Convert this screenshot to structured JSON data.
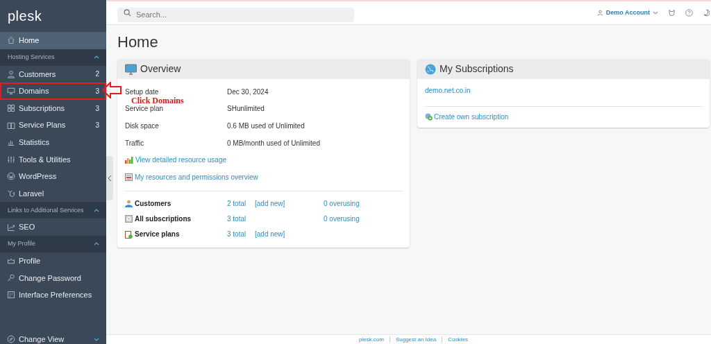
{
  "logo": "plesk",
  "sidebar": {
    "items": [
      {
        "kind": "item",
        "label": "Home",
        "selected": true,
        "annotated": false
      },
      {
        "kind": "section",
        "label": "Hosting Services",
        "expanded": true
      },
      {
        "kind": "item",
        "label": "Customers",
        "count": "2",
        "selected": false,
        "annotated": false
      },
      {
        "kind": "item",
        "label": "Domains",
        "count": "3",
        "selected": false,
        "annotated": true
      },
      {
        "kind": "item",
        "label": "Subscriptions",
        "count": "3",
        "selected": false,
        "annotated": false
      },
      {
        "kind": "item",
        "label": "Service Plans",
        "count": "3",
        "selected": false,
        "annotated": false
      },
      {
        "kind": "item",
        "label": "Statistics",
        "selected": false,
        "annotated": false
      },
      {
        "kind": "item",
        "label": "Tools & Utilities",
        "selected": false,
        "annotated": false
      },
      {
        "kind": "item",
        "label": "WordPress",
        "selected": false,
        "annotated": false
      },
      {
        "kind": "item",
        "label": "Laravel",
        "selected": false,
        "annotated": false
      },
      {
        "kind": "section",
        "label": "Links to Additional Services",
        "expanded": true
      },
      {
        "kind": "item",
        "label": "SEO",
        "selected": false,
        "annotated": false
      },
      {
        "kind": "section",
        "label": "My Profile",
        "expanded": true
      },
      {
        "kind": "item",
        "label": "Profile",
        "selected": false,
        "annotated": false
      },
      {
        "kind": "item",
        "label": "Change Password",
        "selected": false,
        "annotated": false
      },
      {
        "kind": "item",
        "label": "Interface Preferences",
        "selected": false,
        "annotated": false
      }
    ],
    "change_view": {
      "label": "Change View",
      "expanded": false
    }
  },
  "topbar": {
    "search": {
      "placeholder": "Search..."
    },
    "account": "Demo Account"
  },
  "page_title": "Home",
  "overview": {
    "title": "Overview",
    "details": [
      {
        "label": "Setup date",
        "value": "Dec 30, 2024"
      },
      {
        "label": "Service plan",
        "value": "SHunlimited"
      },
      {
        "label": "Disk space",
        "value": "0.6 MB used of Unlimited"
      },
      {
        "label": "Traffic",
        "value": "0 MB/month used of Unlimited"
      }
    ],
    "links": [
      "View detailed resource usage",
      "My resources and permissions overview"
    ],
    "stats": [
      {
        "label": "Customers",
        "total": "2 total",
        "add_new": "[add new]",
        "overusing": "0 overusing"
      },
      {
        "label": "All subscriptions",
        "total": "3 total",
        "overusing": "0 overusing"
      },
      {
        "label": "Service plans",
        "total": "3 total",
        "add_new": "[add new]"
      }
    ]
  },
  "subscriptions": {
    "title": "My Subscriptions",
    "items": [
      "demo.net.co.in"
    ],
    "create_link": "Create own subscription"
  },
  "footer": {
    "links": [
      "plesk.com",
      "Suggest an Idea",
      "Cookies"
    ]
  },
  "annotation": {
    "label": "Click Domains"
  }
}
